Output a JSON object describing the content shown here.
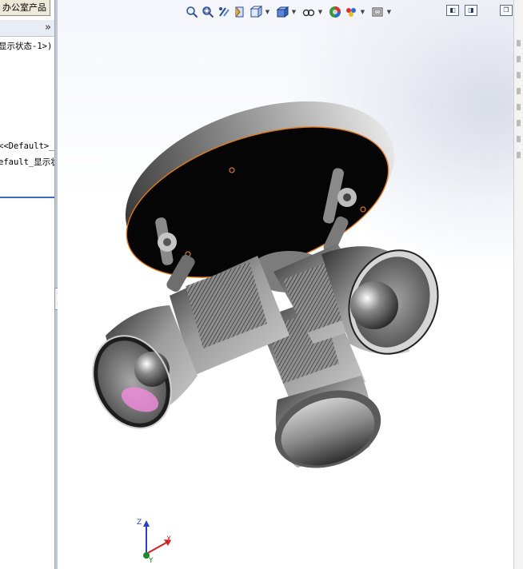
{
  "feature_tree": {
    "tab_label": "办公室产品",
    "collapse_glyph": "»",
    "lines": [
      "显示状态-1>)",
      "<<Default>_",
      "efault_显示状"
    ]
  },
  "toolbar": {
    "icons": [
      "zoom-to-fit-icon",
      "zoom-to-area-icon",
      "previous-view-icon",
      "section-view-icon",
      "view-orientation-icon",
      "display-style-icon",
      "hide-show-items-icon",
      "edit-appearance-icon",
      "apply-scene-icon",
      "view-settings-icon"
    ]
  },
  "window_controls": {
    "icons": [
      "tile-left-icon",
      "tile-right-icon",
      "restore-icon"
    ]
  },
  "triad": {
    "labels": [
      "Z",
      "X",
      "Y"
    ]
  },
  "colors": {
    "highlight_edge": "#e0781a",
    "model_shade": "#6a6a6a",
    "selection_glow": "#f48ce0"
  }
}
